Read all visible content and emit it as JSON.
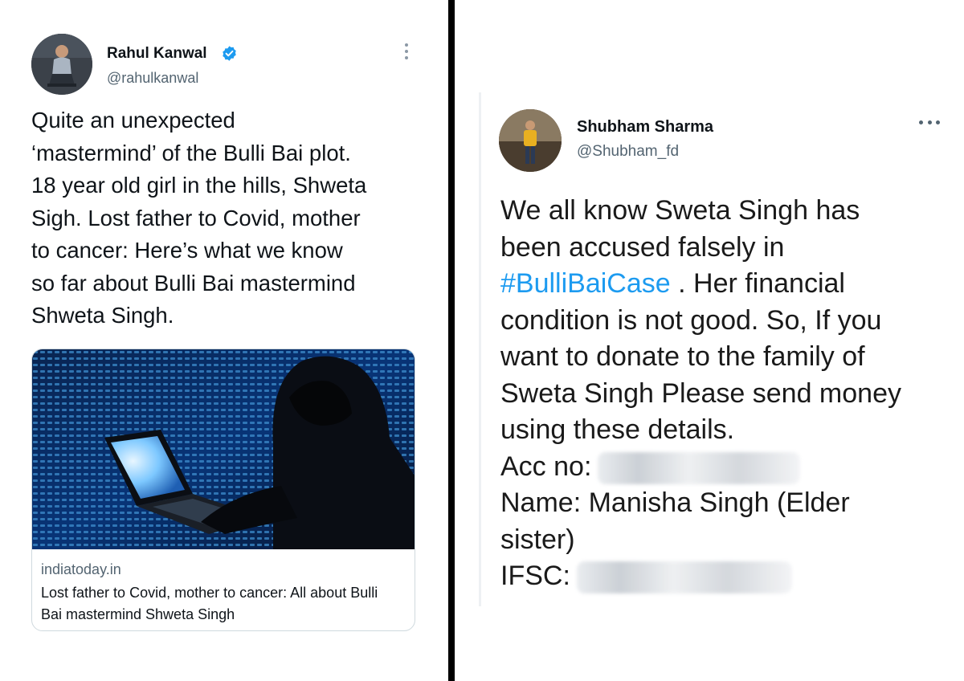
{
  "left_tweet": {
    "author_name": "Rahul Kanwal",
    "handle": "@rahulkanwal",
    "text_lines": [
      "Quite an unexpected",
      "‘mastermind’ of the Bulli Bai plot.",
      "18 year old girl in the hills, Shweta",
      "Sigh. Lost father to Covid, mother",
      "to cancer: Here’s what we know",
      "so far about Bulli Bai mastermind",
      "Shweta Singh."
    ],
    "card": {
      "domain": "indiatoday.in",
      "title": "Lost father to Covid, mother to cancer: All about Bulli Bai mastermind Shweta Singh"
    }
  },
  "right_tweet": {
    "author_name": "Shubham Sharma",
    "handle": "@Shubham_fd",
    "line1": "We all know Sweta Singh has",
    "line2": "been accused falsely in",
    "hashtag": "#BulliBaiCase",
    "line3_rest": " . Her financial",
    "line4": "condition is not good. So, If you",
    "line5": "want to donate to the family of",
    "line6": "Sweta Singh Please send money",
    "line7": "using these details.",
    "acc_label": "Acc no:",
    "name_line": "Name: Manisha Singh (Elder",
    "name_line2": "sister)",
    "ifsc_label": "IFSC:"
  },
  "colors": {
    "accent": "#1d9bf0",
    "secondary_text": "#536471",
    "divider": "#000000"
  },
  "icons": [
    "verified-badge-icon",
    "more-vertical-icon",
    "more-horizontal-icon"
  ]
}
